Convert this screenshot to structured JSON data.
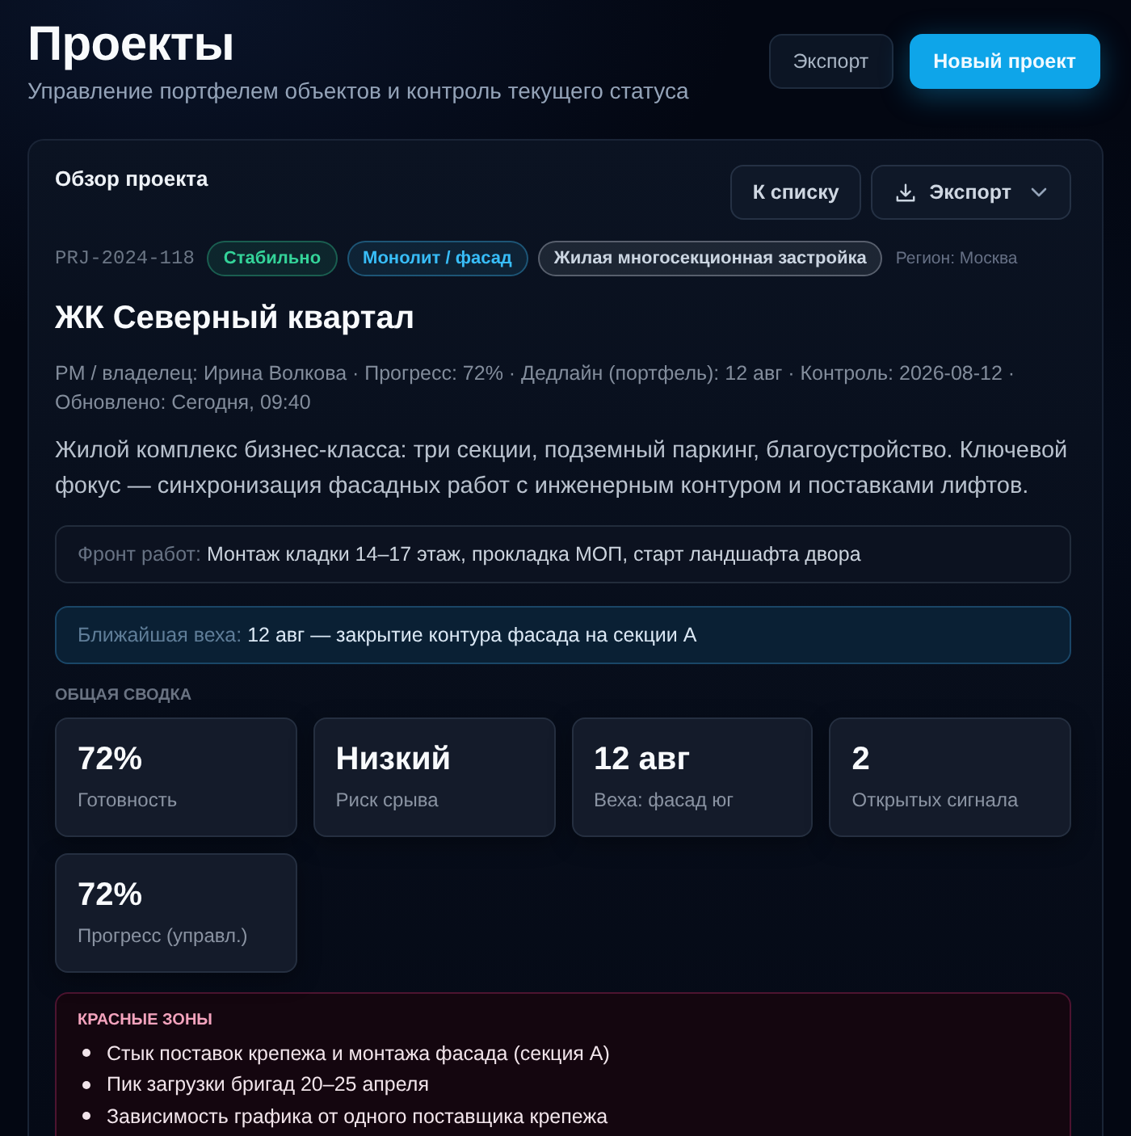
{
  "header": {
    "title": "Проекты",
    "subtitle": "Управление портфелем объектов и контроль текущего статуса",
    "buttons": [
      {
        "label": "Экспорт",
        "kind": "secondary"
      },
      {
        "label": "Новый проект",
        "kind": "primary"
      }
    ]
  },
  "overview": {
    "heading": "Обзор проекта",
    "buttons": [
      {
        "label": "К списку",
        "kind": "plain"
      },
      {
        "label": "Экспорт",
        "kind": "dropdown"
      }
    ],
    "project_id": "PRJ-2024-118",
    "tags": [
      {
        "label": "Стабильно",
        "color": "#34d399"
      },
      {
        "label": "Монолит / фасад",
        "color": "#38bdf8"
      },
      {
        "label": "Жилая многосекционная застройка",
        "color": "#cbd5e1"
      }
    ],
    "region": "Регион: Москва",
    "name": "ЖК Северный квартал",
    "meta": "PM / владелец: Ирина Волкова · Прогресс: 72% · Дедлайн (портфель): 12 авг · Контроль: 2026-08-12 · Обновлено: Сегодня, 09:40",
    "description": "Жилой комплекс бизнес-класса: три секции, подземный паркинг, благоустройство. Ключевой фокус — синхронизация фасадных работ с инженерным контуром и поставками лифтов.",
    "work_front": {
      "label": "Фронт работ:",
      "value": "Монтаж кладки 14–17 этаж, прокладка МОП, старт ландшафта двора"
    },
    "milestone": {
      "label": "Ближайшая веха:",
      "value": "12 авг — закрытие контура фасада на секции А"
    },
    "summary": {
      "heading": "ОБЩАЯ СВОДКА",
      "stats": [
        {
          "value": "72%",
          "label": "Готовность"
        },
        {
          "value": "Низкий",
          "label": "Риск срыва"
        },
        {
          "value": "12 авг",
          "label": "Веха: фасад юг"
        },
        {
          "value": "2",
          "label": "Открытых сигнала"
        },
        {
          "value": "72%",
          "label": "Прогресс (управл.)"
        }
      ]
    },
    "red_zones": {
      "heading": "КРАСНЫЕ ЗОНЫ",
      "items": [
        "Стык поставок крепежа и монтажа фасада (секция А)",
        "Пик загрузки бригад 20–25 апреля",
        "Зависимость графика от одного поставщика крепежа"
      ]
    }
  }
}
